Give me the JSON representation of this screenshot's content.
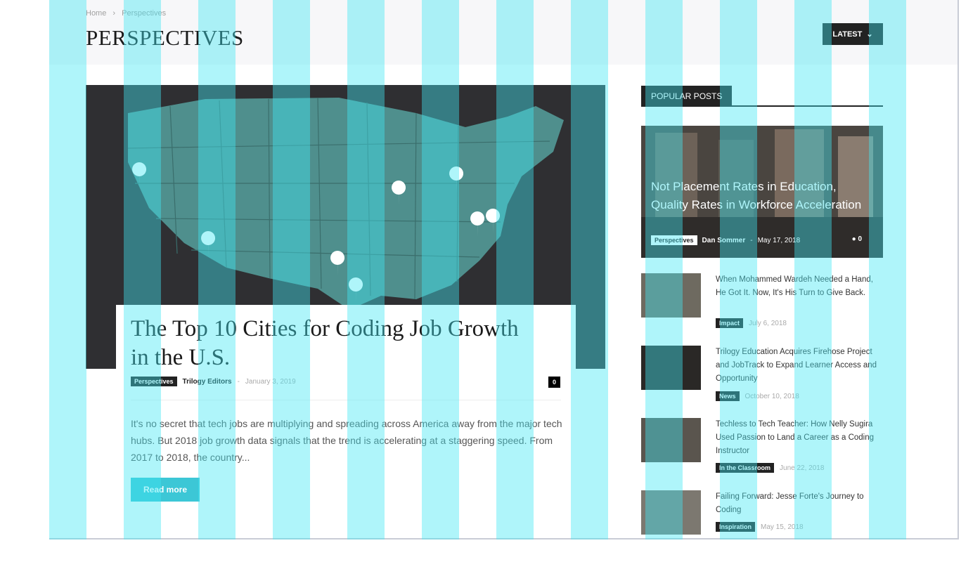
{
  "breadcrumb": [
    "Home",
    "›",
    "Perspectives"
  ],
  "page_title": "PERSPECTIVES",
  "sort_button": "LATEST",
  "hero": {
    "title": "The Top 10 Cities for Coding Job Growth in the U.S.",
    "category": "Perspectives",
    "author": "Trilogy Editors",
    "separator": "-",
    "date": "January 3, 2019",
    "comments": "0",
    "excerpt": "It's no secret that tech jobs are multiplying and spreading across America away from the major tech hubs. But 2018 job growth data signals that the trend is accelerating at a staggering speed. From 2017 to 2018, the country...",
    "read_more": "Read more"
  },
  "popular": {
    "heading": "POPULAR POSTS",
    "feature": {
      "title": "Not Placement Rates in Education, Quality Rates in Workforce Acceleration",
      "category": "Perspectives",
      "author": "Dan Sommer",
      "separator": "-",
      "date": "May 17, 2018",
      "comments": "0"
    },
    "items": [
      {
        "title": "When Mohammed Wardeh Needed a Hand, He Got It. Now, It's His Turn to Give Back.",
        "category": "Impact",
        "date": "July 6, 2018"
      },
      {
        "title": "Trilogy Education Acquires Firehose Project and JobTrack to Expand Learner Access and Opportunity",
        "category": "News",
        "date": "October 10, 2018"
      },
      {
        "title": "Techless to Tech Teacher: How Nelly Sugira Used Passion to Land a Career as a Coding Instructor",
        "category": "In the Classroom",
        "date": "June 22, 2018"
      },
      {
        "title": "Failing Forward: Jesse Forte's Journey to Coding",
        "category": "Inspiration",
        "date": "May 15, 2018"
      }
    ]
  },
  "colors": {
    "grid_overlay": "#40e6f2",
    "accent": "#3cc7d6",
    "dark": "#222222",
    "map": "#4f8f8d"
  },
  "icons": {
    "dropdown": "chevron-down-icon",
    "comments": "comment-icon",
    "map_pins": "map-pin-icon"
  }
}
